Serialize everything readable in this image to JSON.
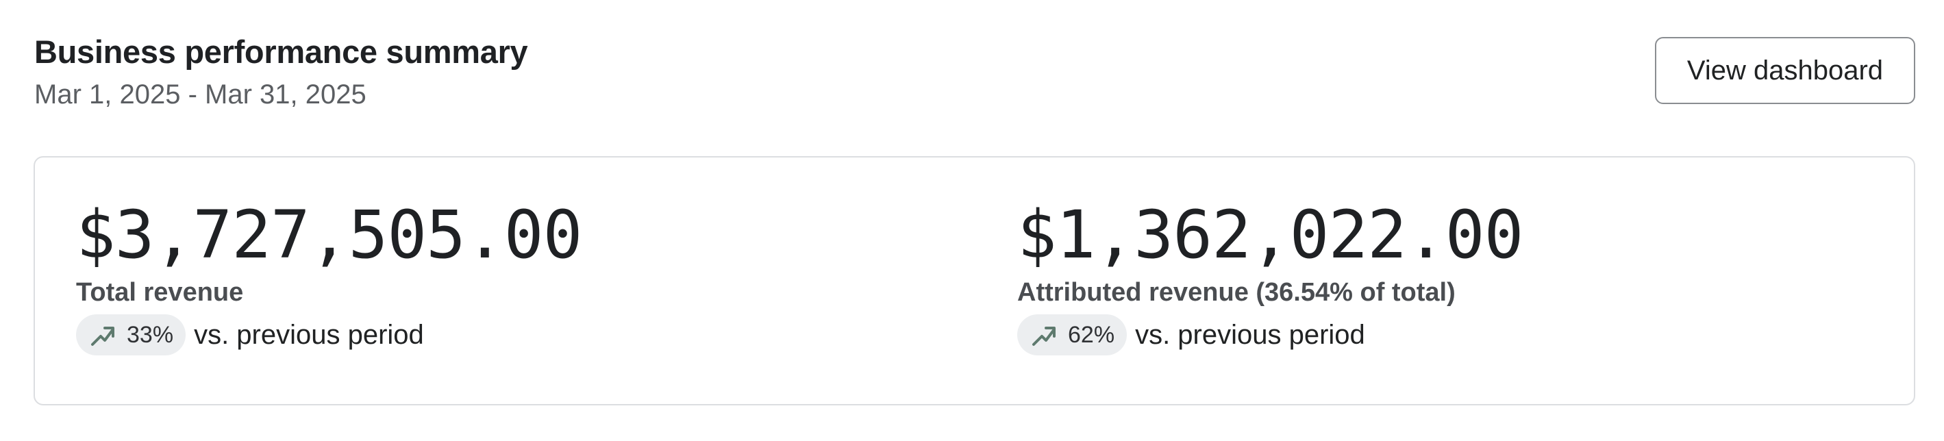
{
  "header": {
    "title": "Business performance summary",
    "date_range": "Mar 1, 2025 - Mar 31, 2025",
    "view_dashboard_label": "View dashboard"
  },
  "metrics": [
    {
      "value": "$3,727,505.00",
      "label": "Total revenue",
      "change": "33%",
      "comparison": "vs. previous period",
      "trend_icon": "trend-up-icon"
    },
    {
      "value": "$1,362,022.00",
      "label": "Attributed revenue (36.54% of total)",
      "change": "62%",
      "comparison": "vs. previous period",
      "trend_icon": "trend-up-icon"
    }
  ],
  "colors": {
    "pill_background": "#eceef0",
    "trend_icon": "#5e7a6e",
    "card_border": "#dcdee1"
  }
}
